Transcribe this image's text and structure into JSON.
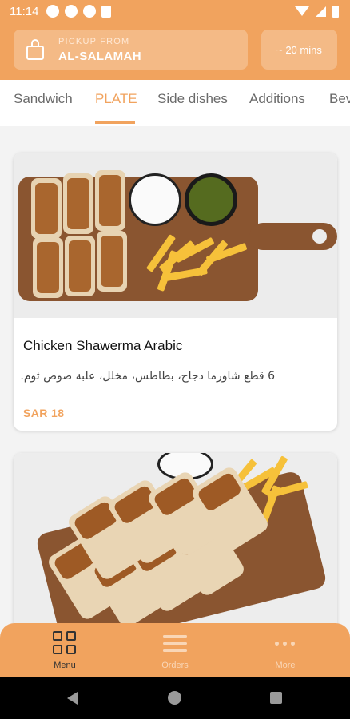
{
  "status_bar": {
    "time": "11:14"
  },
  "header": {
    "pickup_label": "PICKUP FROM",
    "pickup_branch": "AL-SALAMAH",
    "eta": "~ 20 mins",
    "accent_color": "#f1a35e"
  },
  "tabs": [
    {
      "label": "Sandwich",
      "active": false
    },
    {
      "label": "PLATE",
      "active": true
    },
    {
      "label": "Side dishes",
      "active": false
    },
    {
      "label": "Additions",
      "active": false
    },
    {
      "label": "Bev",
      "active": false
    }
  ],
  "products": [
    {
      "name": "Chicken Shawerma Arabic",
      "description": "6 قطع شاورما دجاج، بطاطس، مخلل، علبة صوص ثوم.",
      "price": "SAR 18"
    }
  ],
  "bottom_nav": [
    {
      "label": "Menu",
      "icon": "grid-icon",
      "active": true
    },
    {
      "label": "Orders",
      "icon": "list-icon",
      "active": false
    },
    {
      "label": "More",
      "icon": "more-dots-icon",
      "active": false
    }
  ]
}
